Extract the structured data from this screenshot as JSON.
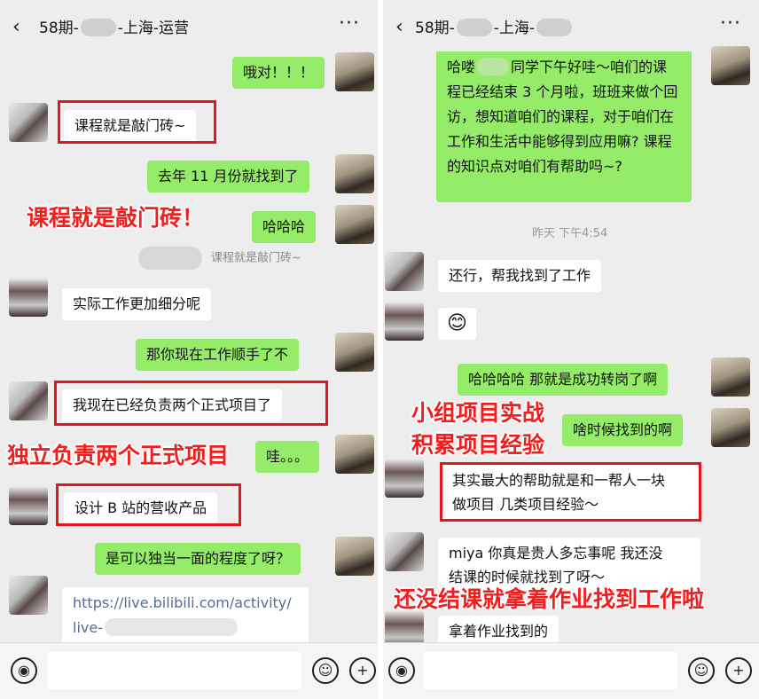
{
  "left": {
    "title_prefix": "58期-",
    "title_suffix": "-上海-运营",
    "back_glyph": "‹",
    "more_glyph": "···",
    "messages": {
      "m1": "哦对！！！",
      "m2": "课程就是敲门砖~",
      "m3": "去年 11 月份就找到了",
      "m4": "哈哈哈",
      "m5_recalled": "课程就是敲门砖~",
      "m6": "实际工作更加细分呢",
      "m7": "那你现在工作顺手了不",
      "m8": "我现在已经负责两个正式项目了",
      "m9": "哇。。。",
      "m10": "设计 B 站的营收产品",
      "m11": "是可以独当一面的程度了呀？",
      "m12_line1": "https://live.bilibili.com/activity/",
      "m12_line2": "live-"
    },
    "annotations": {
      "a1": "课程就是敲门砖！",
      "a2": "独立负责两个正式项目"
    }
  },
  "right": {
    "title_prefix": "58期-",
    "title_mid": "-上海-",
    "back_glyph": "‹",
    "more_glyph": "···",
    "timestamp": "昨天 下午4:54",
    "messages": {
      "r1_part1": "哈喽",
      "r1_part2": "同学下午好哇～咱们的课程已经结束 3 个月啦，班班来做个回访，想知道咱们的课程，对于咱们在工作和生活中能够得到应用嘛? 课程的知识点对咱们有帮助吗~?",
      "r2": "还行，帮我找到了工作",
      "r3_emoji": "😊",
      "r4": "哈哈哈哈 那就是成功转岗了啊",
      "r5": "啥时候找到的啊",
      "r6_line1": "其实最大的帮助就是和一帮人一块",
      "r6_line2": "做项目 几类项目经验～",
      "r7_line1": "miya 你真是贵人多忘事呢 我还没",
      "r7_line2": "结课的时候就找到了呀～",
      "r8": "拿着作业找到的"
    },
    "annotations": {
      "b1": "小组项目实战",
      "b2": "积累项目经验",
      "b3": "还没结课就拿着作业找到工作啦"
    }
  },
  "input": {
    "voice_glyph": "◉",
    "emoji_glyph": "☺",
    "plus_glyph": "+"
  },
  "colors": {
    "chat_bg": "#ededed",
    "self_bubble": "#95ec69",
    "other_bubble": "#ffffff",
    "highlight_red": "#e6141c",
    "link": "#576b95"
  }
}
